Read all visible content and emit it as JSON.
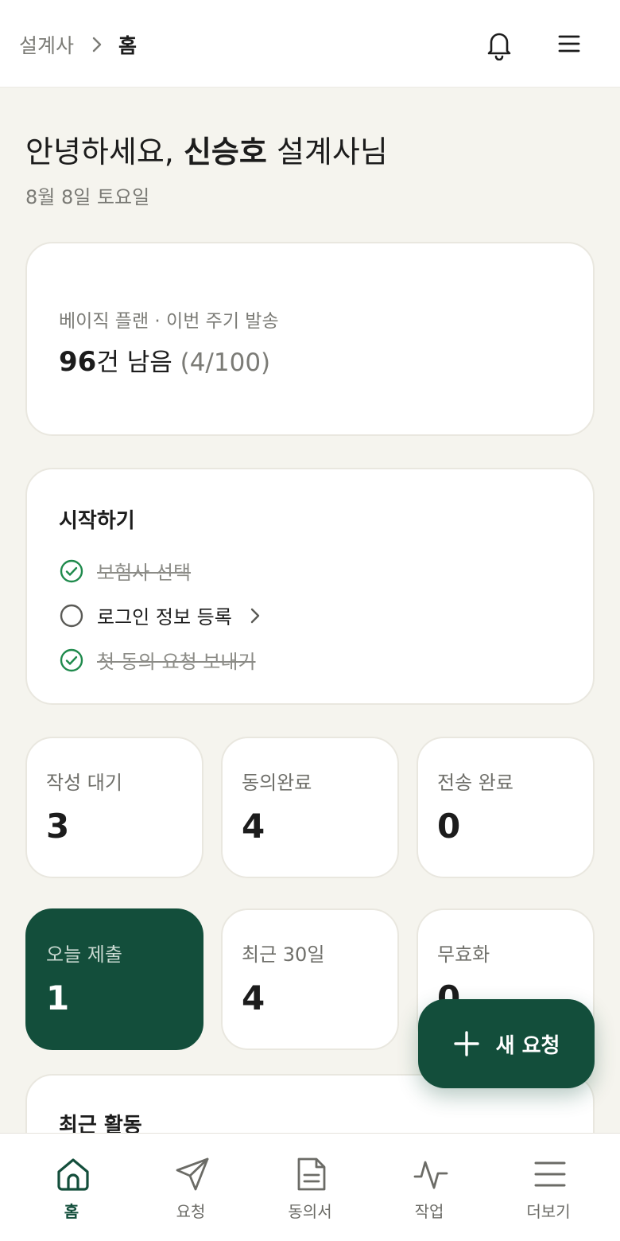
{
  "header": {
    "breadcrumb_parent": "설계사",
    "breadcrumb_current": "홈",
    "icons": [
      "chevron-right-icon",
      "bell-icon",
      "menu-icon"
    ]
  },
  "greeting": {
    "prefix": "안녕하세요, ",
    "name": "신승호",
    "suffix": " 설계사님",
    "date": "8월 8일 토요일"
  },
  "plan": {
    "label": "베이직 플랜 · 이번 주기 발송",
    "remaining": "96",
    "remaining_suffix": "건 남음",
    "usage": "(4/100)"
  },
  "getting_started": {
    "title": "시작하기",
    "tasks": [
      {
        "label": "보험사 선택",
        "done": true
      },
      {
        "label": "로그인 정보 등록",
        "done": false
      },
      {
        "label": "첫 동의 요청 보내기",
        "done": true
      }
    ]
  },
  "stats": [
    {
      "label": "작성 대기",
      "value": "3"
    },
    {
      "label": "동의완료",
      "value": "4"
    },
    {
      "label": "전송 완료",
      "value": "0"
    },
    {
      "label": "오늘 제출",
      "value": "1",
      "active": true
    },
    {
      "label": "최근 30일",
      "value": "4"
    },
    {
      "label": "무효화",
      "value": "0"
    }
  ],
  "recent_activity": {
    "title": "최근 활동"
  },
  "fab": {
    "label": "새 요청",
    "icon": "plus-icon"
  },
  "bottom_nav": [
    {
      "label": "홈",
      "icon": "home-icon",
      "active": true
    },
    {
      "label": "요청",
      "icon": "send-icon"
    },
    {
      "label": "동의서",
      "icon": "document-icon"
    },
    {
      "label": "작업",
      "icon": "activity-icon"
    },
    {
      "label": "더보기",
      "icon": "menu-icon"
    }
  ],
  "colors": {
    "accent": "#134e3b",
    "background": "#f5f4ee",
    "card": "#ffffff",
    "check": "#1f8a4c",
    "muted": "#7b7b76"
  }
}
